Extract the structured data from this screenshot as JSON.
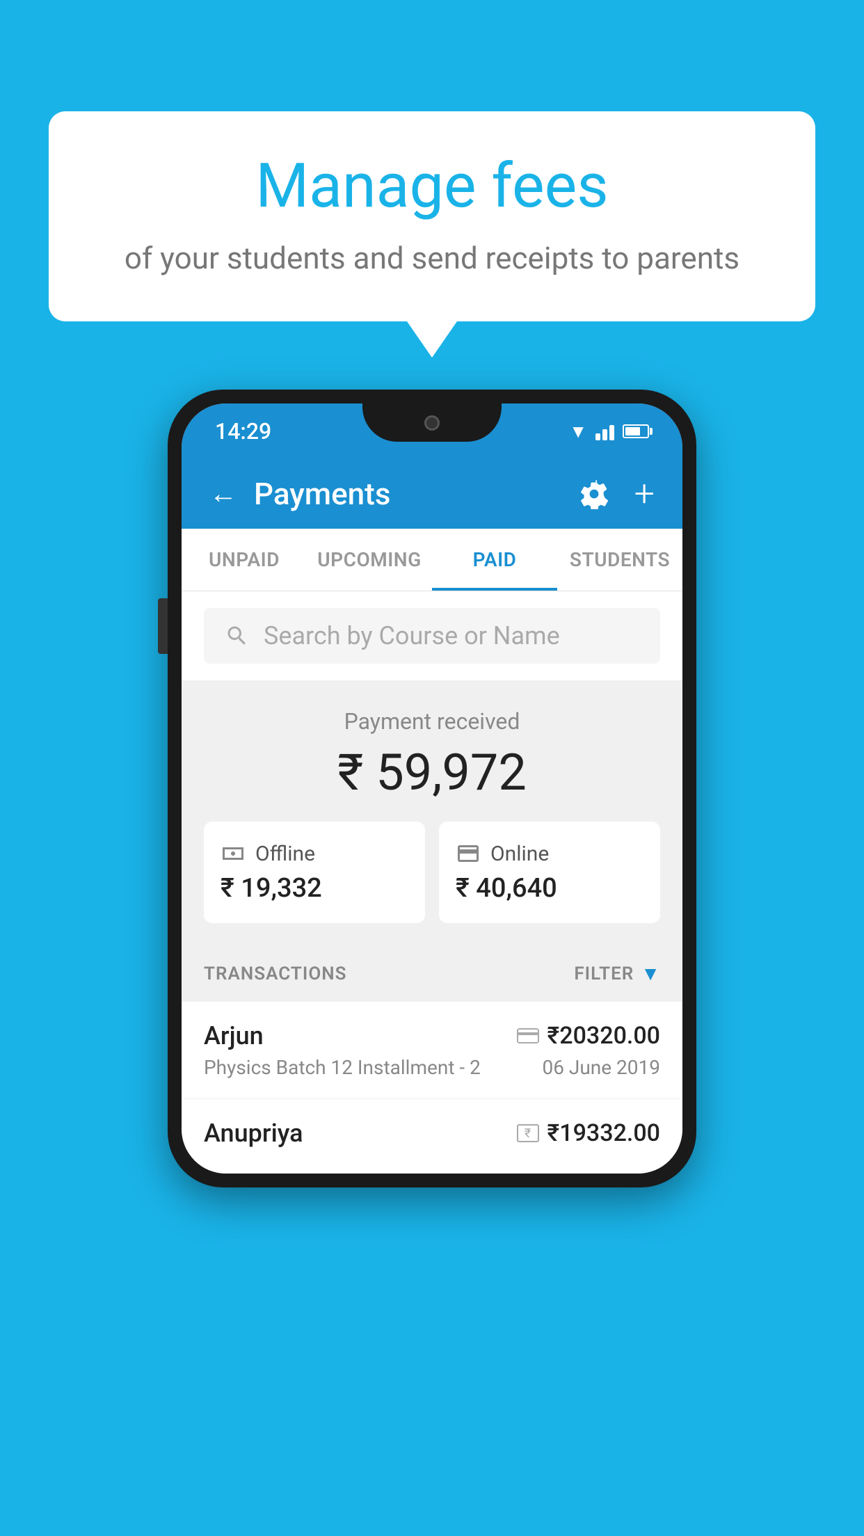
{
  "background_color": "#1ab3e8",
  "speech_bubble": {
    "title": "Manage fees",
    "subtitle": "of your students and send receipts to parents"
  },
  "status_bar": {
    "time": "14:29"
  },
  "header": {
    "title": "Payments",
    "back_label": "←",
    "plus_label": "+"
  },
  "tabs": [
    {
      "label": "UNPAID",
      "active": false
    },
    {
      "label": "UPCOMING",
      "active": false
    },
    {
      "label": "PAID",
      "active": true
    },
    {
      "label": "STUDENTS",
      "active": false
    }
  ],
  "search": {
    "placeholder": "Search by Course or Name"
  },
  "payment_summary": {
    "label": "Payment received",
    "amount": "₹ 59,972",
    "offline_label": "Offline",
    "offline_amount": "₹ 19,332",
    "online_label": "Online",
    "online_amount": "₹ 40,640"
  },
  "transactions": {
    "header_label": "TRANSACTIONS",
    "filter_label": "FILTER",
    "rows": [
      {
        "name": "Arjun",
        "amount": "₹20320.00",
        "description": "Physics Batch 12 Installment - 2",
        "date": "06 June 2019",
        "payment_type": "card"
      },
      {
        "name": "Anupriya",
        "amount": "₹19332.00",
        "description": "",
        "date": "",
        "payment_type": "cash"
      }
    ]
  }
}
